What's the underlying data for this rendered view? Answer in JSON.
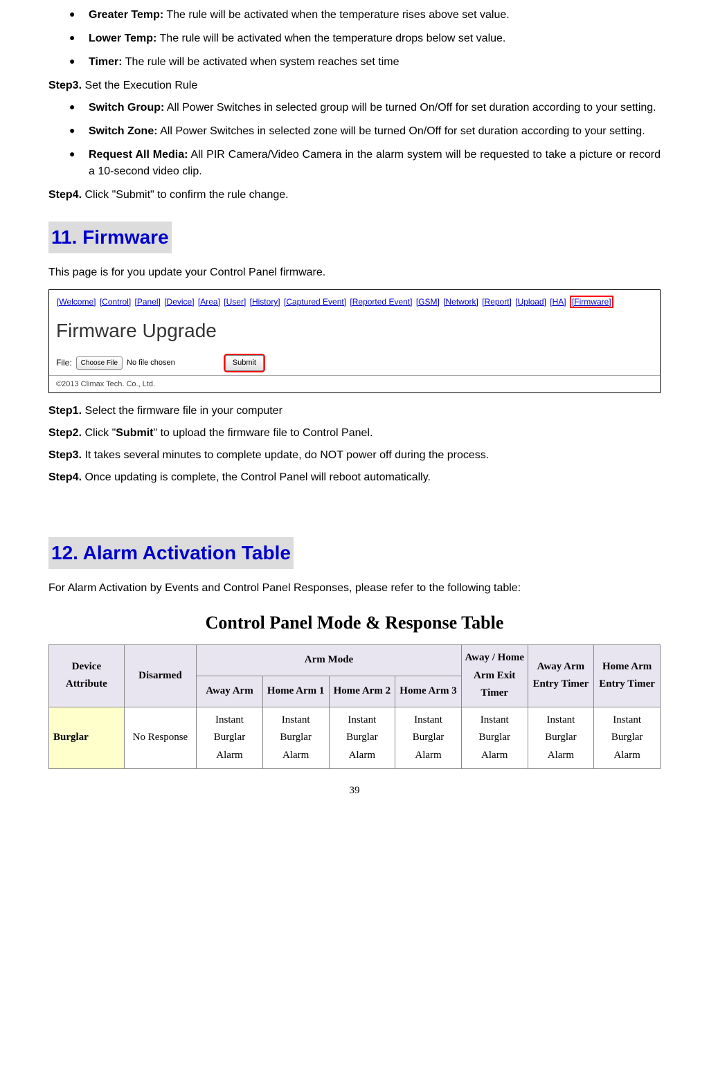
{
  "bullets_top": [
    {
      "label": "Greater Temp:",
      "text": " The rule will be activated when the temperature rises above set value."
    },
    {
      "label": "Lower Temp:",
      "text": " The rule will be activated when the temperature drops below set value."
    },
    {
      "label": "Timer:",
      "text": " The rule will be activated when system reaches set time"
    }
  ],
  "step3_heading": {
    "strong": "Step3.",
    "rest": " Set the Execution Rule"
  },
  "bullets_exec": [
    {
      "label": "Switch Group:",
      "text": " All Power Switches in selected group will be turned On/Off for set duration according to your setting."
    },
    {
      "label": "Switch Zone:",
      "text": " All Power Switches in selected zone will be turned On/Off for set duration according to your setting."
    },
    {
      "label": "Request All Media:",
      "text": " All PIR Camera/Video Camera in the alarm system will be requested to take a picture or record a 10-second video clip."
    }
  ],
  "step4_line": {
    "strong": "Step4.",
    "rest": " Click \"Submit\" to confirm the rule change."
  },
  "sec11": "11. Firmware",
  "sec11_intro": "This page is for you update your Control Panel firmware.",
  "nav": [
    "[Welcome]",
    "[Control]",
    "[Panel]",
    "[Device]",
    "[Area]",
    "[User]",
    "[History]",
    "[Captured Event]",
    "[Reported Event]",
    "[GSM]",
    "[Network]",
    "[Report]",
    "[Upload]",
    "[HA]",
    "[Firmware]"
  ],
  "fw_title": "Firmware Upgrade",
  "fw_file_label": "File:",
  "fw_choose": "Choose File",
  "fw_nofile": "No file chosen",
  "fw_submit": "Submit",
  "fw_copy": "©2013 Climax Tech. Co., Ltd.",
  "fw_steps": [
    {
      "strong": "Step1.",
      "rest": " Select the firmware file in your computer"
    },
    {
      "strong": "Step2.",
      "rest_pre": " Click \"",
      "bold": "Submit",
      "rest_post": "\" to upload the firmware file to Control Panel."
    },
    {
      "strong": "Step3.",
      "rest": " It takes several minutes to complete update, do NOT power off during the process."
    },
    {
      "strong": "Step4.",
      "rest": " Once updating is complete, the Control Panel will reboot automatically."
    }
  ],
  "sec12": "12. Alarm Activation Table",
  "sec12_intro": "For Alarm Activation by Events and Control Panel Responses, please refer to the following table:",
  "table_title": "Control Panel Mode & Response Table",
  "headers": {
    "device_attr": "Device Attribute",
    "disarmed": "Disarmed",
    "arm_mode": "Arm Mode",
    "away_arm": "Away Arm",
    "home_arm_1": "Home Arm 1",
    "home_arm_2": "Home Arm 2",
    "home_arm_3": "Home Arm 3",
    "exit_timer": "Away / Home Arm Exit Timer",
    "away_entry": "Away Arm Entry Timer",
    "home_entry": "Home Arm Entry Timer"
  },
  "row_burglar": {
    "attr": "Burglar",
    "disarmed": "No Response",
    "cells": [
      "Instant Burglar Alarm",
      "Instant Burglar Alarm",
      "Instant Burglar Alarm",
      "Instant Burglar Alarm",
      "Instant Burglar Alarm",
      "Instant Burglar Alarm",
      "Instant Burglar Alarm"
    ]
  },
  "page_number": "39"
}
